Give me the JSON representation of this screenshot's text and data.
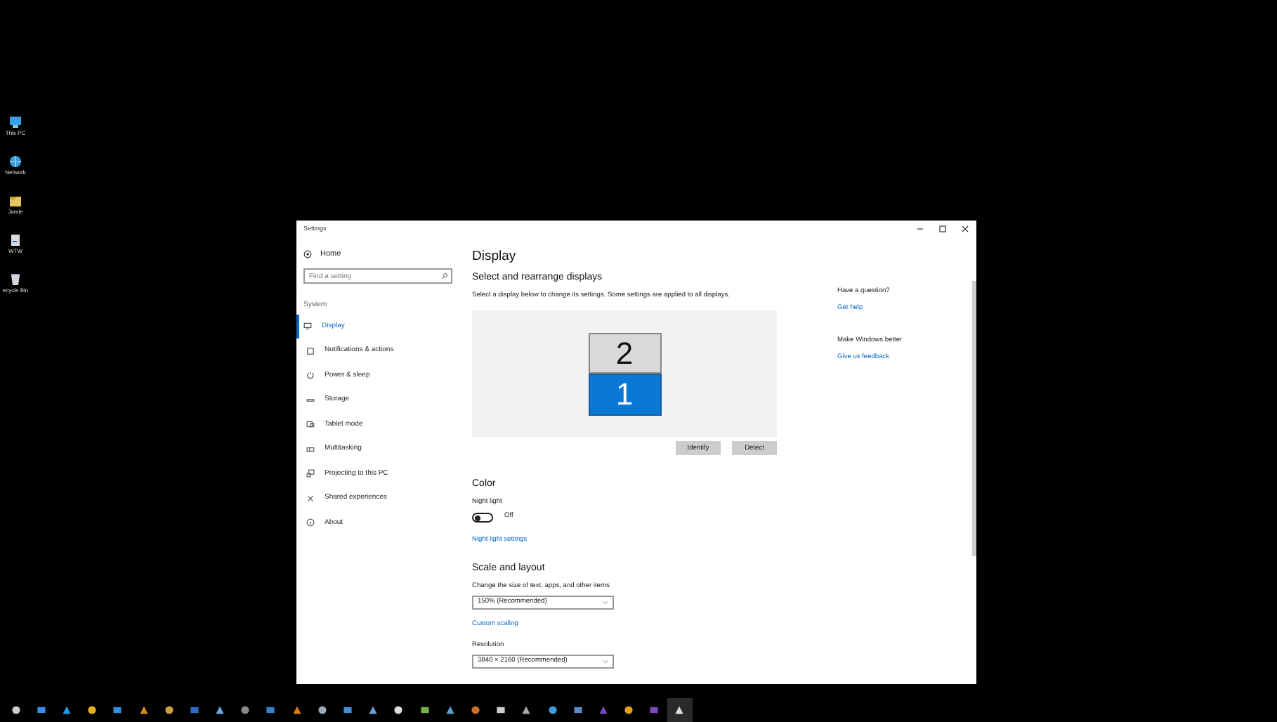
{
  "desktop_icons": [
    {
      "label": "This PC"
    },
    {
      "label": "Network"
    },
    {
      "label": "Jamie"
    },
    {
      "label": "WTW"
    },
    {
      "label": "ecycle Bin"
    }
  ],
  "window": {
    "title": "Settings"
  },
  "sidebar": {
    "home": "Home",
    "search": {
      "placeholder": "Find a setting"
    },
    "group": "System",
    "items": [
      {
        "label": "Display",
        "selected": true
      },
      {
        "label": "Notifications & actions",
        "selected": false
      },
      {
        "label": "Power & sleep",
        "selected": false
      },
      {
        "label": "Storage",
        "selected": false
      },
      {
        "label": "Tablet mode",
        "selected": false
      },
      {
        "label": "Multitasking",
        "selected": false
      },
      {
        "label": "Projecting to this PC",
        "selected": false
      },
      {
        "label": "Shared experiences",
        "selected": false
      },
      {
        "label": "About",
        "selected": false
      }
    ]
  },
  "content": {
    "title": "Display",
    "arrange": {
      "heading": "Select and rearrange displays",
      "description": "Select a display below to change its settings. Some settings are applied to all displays.",
      "monitors": [
        {
          "label": "2",
          "selected": false
        },
        {
          "label": "1",
          "selected": true
        }
      ],
      "buttons": [
        "Identify",
        "Detect"
      ]
    },
    "color": {
      "heading": "Color",
      "night_light": {
        "label": "Night light",
        "on": false,
        "state": "Off"
      },
      "link": "Night light settings"
    },
    "scale": {
      "heading": "Scale and layout",
      "size_label": "Change the size of text, apps, and other items",
      "size_value": "150% (Recommended)",
      "link": "Custom scaling",
      "resolution_label": "Resolution",
      "resolution_value": "3840 × 2160 (Recommended)"
    }
  },
  "aside": [
    {
      "question": "Have a question?",
      "link": "Get help"
    },
    {
      "question": "Make Windows better",
      "link": "Give us feedback"
    }
  ],
  "taskbar": {
    "apps": [
      {
        "selected": false
      },
      {
        "selected": false
      },
      {
        "selected": false
      },
      {
        "selected": false
      },
      {
        "selected": false
      },
      {
        "selected": false
      },
      {
        "selected": false
      },
      {
        "selected": false
      },
      {
        "selected": false
      },
      {
        "selected": false
      },
      {
        "selected": false
      },
      {
        "selected": false
      },
      {
        "selected": false
      },
      {
        "selected": false
      },
      {
        "selected": false
      },
      {
        "selected": false
      },
      {
        "selected": false
      },
      {
        "selected": false
      },
      {
        "selected": false
      },
      {
        "selected": false
      },
      {
        "selected": false
      },
      {
        "selected": false
      },
      {
        "selected": false
      },
      {
        "selected": false
      },
      {
        "selected": false
      },
      {
        "selected": false
      },
      {
        "selected": true
      }
    ]
  }
}
